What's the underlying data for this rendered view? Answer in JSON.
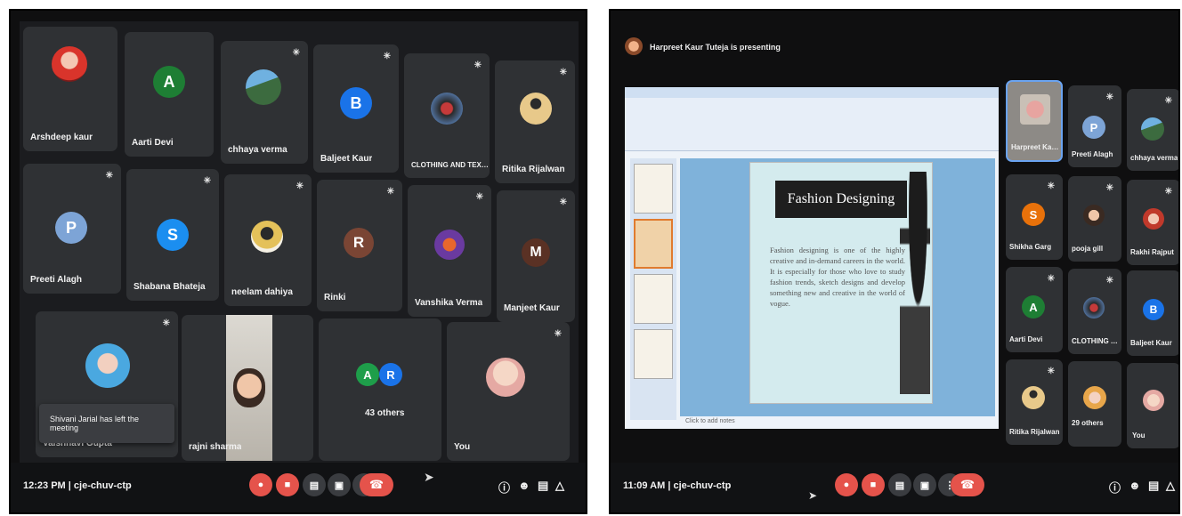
{
  "left": {
    "tiles": [
      {
        "name": "Arshdeep kaur",
        "initial": "",
        "avatar": "photo"
      },
      {
        "name": "Aarti Devi",
        "initial": "A",
        "color": "#1e7e34"
      },
      {
        "name": "chhaya verma",
        "initial": "",
        "avatar": "photo"
      },
      {
        "name": "Baljeet Kaur",
        "initial": "B",
        "color": "#1a73e8"
      },
      {
        "name": "CLOTHING AND TEXTILES",
        "initial": "",
        "avatar": "photo"
      },
      {
        "name": "Ritika Rijalwan",
        "initial": "",
        "avatar": "photo"
      },
      {
        "name": "Preeti Alagh",
        "initial": "P",
        "color": "#7da4d6"
      },
      {
        "name": "Shabana Bhateja",
        "initial": "S",
        "color": "#1b8ef0"
      },
      {
        "name": "neelam dahiya",
        "initial": "",
        "avatar": "photo"
      },
      {
        "name": "Rinki",
        "initial": "R",
        "color": "#7a4534"
      },
      {
        "name": "Vanshika Verma",
        "initial": "",
        "avatar": "photo"
      },
      {
        "name": "Manjeet Kaur",
        "initial": "M",
        "color": "#5a3124"
      },
      {
        "name": "Vaishnavi Gupta",
        "initial": "",
        "avatar": "photo"
      },
      {
        "name": "rajni sharma",
        "initial": "",
        "avatar": "video"
      },
      {
        "name": "43 others",
        "initial": "",
        "avatar": "group"
      },
      {
        "name": "You",
        "initial": "",
        "avatar": "photo"
      }
    ],
    "group_initials": [
      "A",
      "R"
    ],
    "toast": "Shivani Jarial has left the meeting",
    "time": "12:23 PM",
    "meeting_code": "cje-chuv-ctp"
  },
  "right": {
    "presenting": "Harpreet Kaur Tuteja is presenting",
    "slide_title": "Fashion Designing",
    "slide_body": "Fashion designing is one of the highly creative and in-demand careers in the world. It is especially for those who love to study fashion trends, sketch designs and develop something new and creative in the world of vogue.",
    "notes_placeholder": "Click to add notes",
    "tiles": [
      {
        "name": "Harpreet Kaur...",
        "initial": "",
        "avatar": "photo"
      },
      {
        "name": "Preeti Alagh",
        "initial": "P",
        "color": "#7da4d6"
      },
      {
        "name": "chhaya verma",
        "initial": "",
        "avatar": "photo"
      },
      {
        "name": "Shikha Garg",
        "initial": "S",
        "color": "#e8710a"
      },
      {
        "name": "pooja gill",
        "initial": "",
        "avatar": "photo"
      },
      {
        "name": "Rakhi Rajput",
        "initial": "",
        "avatar": "photo"
      },
      {
        "name": "Aarti Devi",
        "initial": "A",
        "color": "#1e7e34"
      },
      {
        "name": "CLOTHING AN...",
        "initial": "",
        "avatar": "photo"
      },
      {
        "name": "Baljeet Kaur",
        "initial": "B",
        "color": "#1a73e8"
      },
      {
        "name": "Ritika Rijalwan",
        "initial": "",
        "avatar": "photo"
      },
      {
        "name": "29 others",
        "initial": "",
        "avatar": "photo"
      },
      {
        "name": "You",
        "initial": "",
        "avatar": "photo"
      }
    ],
    "time": "11:09 AM",
    "meeting_code": "cje-chuv-ctp"
  },
  "separator": "|",
  "colors": {
    "end_call": "#e5534b",
    "tile": "#2f3134",
    "stage": "#1b1c1f"
  }
}
